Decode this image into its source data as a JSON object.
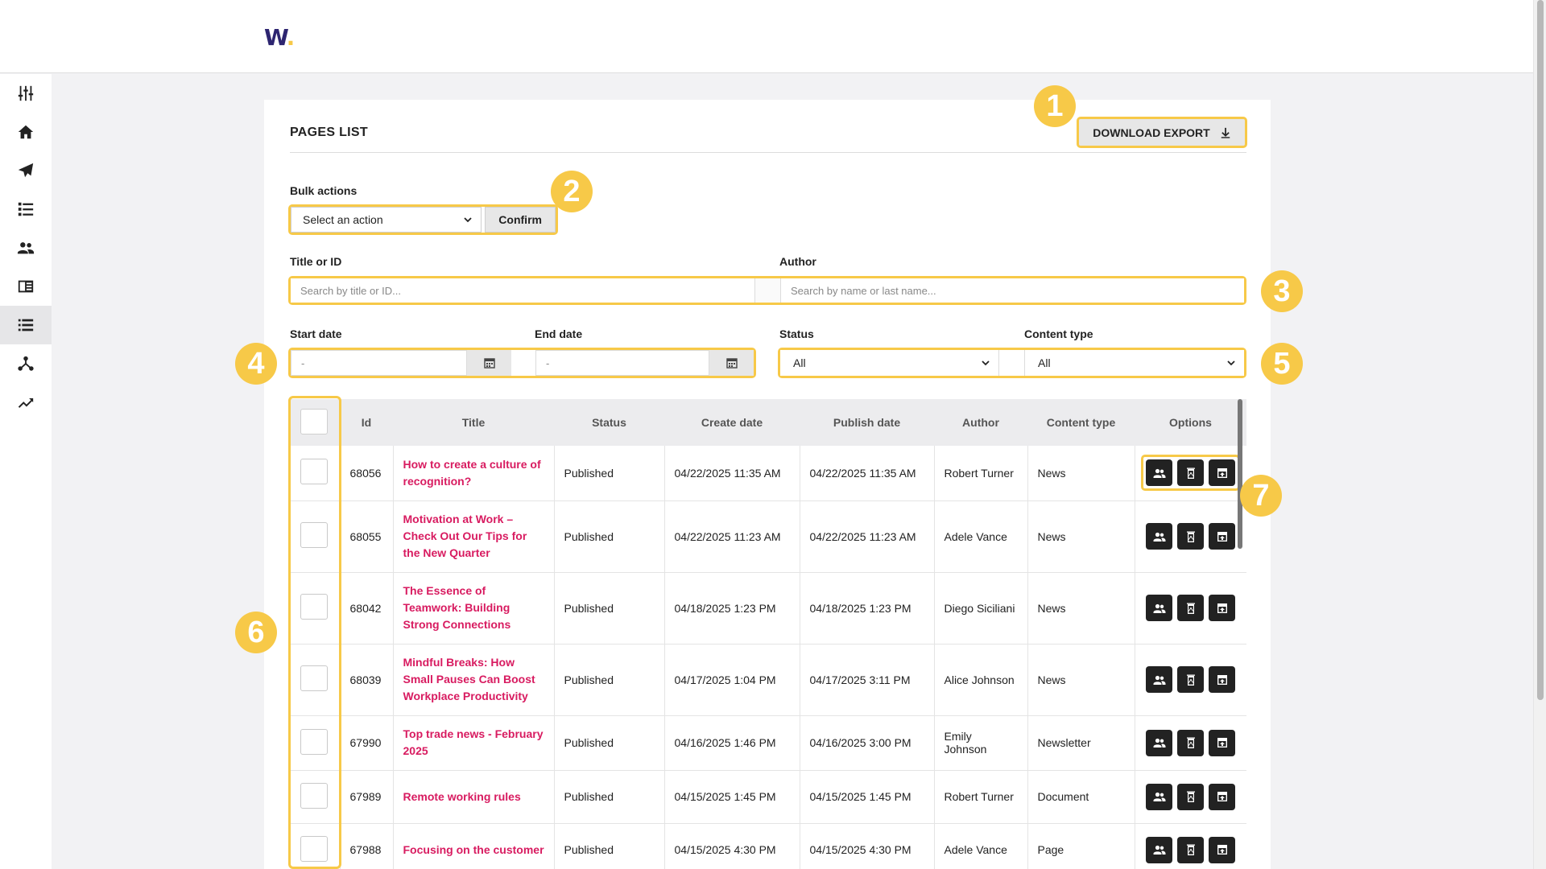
{
  "app": {
    "logo_text": "W",
    "logo_dot": "."
  },
  "colors": {
    "accent": "#f7c948",
    "title_link": "#d81b60",
    "brand": "#2d2570"
  },
  "sidebar": {
    "items": [
      {
        "icon": "sliders-icon"
      },
      {
        "icon": "home-icon"
      },
      {
        "icon": "paper-plane-icon"
      },
      {
        "icon": "list-icon"
      },
      {
        "icon": "users-icon"
      },
      {
        "icon": "newspaper-icon"
      },
      {
        "icon": "pages-icon",
        "active": true
      },
      {
        "icon": "network-icon"
      },
      {
        "icon": "trending-icon"
      }
    ]
  },
  "page": {
    "title": "PAGES LIST",
    "export_label": "DOWNLOAD EXPORT"
  },
  "bulk": {
    "label": "Bulk actions",
    "select_value": "Select an action",
    "confirm_label": "Confirm"
  },
  "search": {
    "title_label": "Title or ID",
    "title_placeholder": "Search by title or ID...",
    "author_label": "Author",
    "author_placeholder": "Search by name or last name..."
  },
  "dates": {
    "start_label": "Start date",
    "start_value": "-",
    "end_label": "End date",
    "end_value": "-"
  },
  "filters": {
    "status_label": "Status",
    "status_value": "All",
    "content_type_label": "Content type",
    "content_type_value": "All"
  },
  "markers": [
    "1",
    "2",
    "3",
    "4",
    "5",
    "6",
    "7"
  ],
  "table": {
    "headers": [
      "Id",
      "Title",
      "Status",
      "Create date",
      "Publish date",
      "Author",
      "Content type",
      "Options"
    ],
    "rows": [
      {
        "id": "68056",
        "title": "How to create a culture of recognition?",
        "status": "Published",
        "create": "04/22/2025 11:35 AM",
        "publish": "04/22/2025 11:35 AM",
        "author": "Robert Turner",
        "type": "News"
      },
      {
        "id": "68055",
        "title": "Motivation at Work – Check Out Our Tips for the New Quarter",
        "status": "Published",
        "create": "04/22/2025 11:23 AM",
        "publish": "04/22/2025 11:23 AM",
        "author": "Adele Vance",
        "type": "News"
      },
      {
        "id": "68042",
        "title": "The Essence of Teamwork: Building Strong Connections",
        "status": "Published",
        "create": "04/18/2025 1:23 PM",
        "publish": "04/18/2025 1:23 PM",
        "author": "Diego Siciliani",
        "type": "News"
      },
      {
        "id": "68039",
        "title": "Mindful Breaks: How Small Pauses Can Boost Workplace Productivity",
        "status": "Published",
        "create": "04/17/2025 1:04 PM",
        "publish": "04/17/2025 3:11 PM",
        "author": "Alice Johnson",
        "type": "News"
      },
      {
        "id": "67990",
        "title": "Top trade news - February 2025",
        "status": "Published",
        "create": "04/16/2025 1:46 PM",
        "publish": "04/16/2025 3:00 PM",
        "author": "Emily Johnson",
        "type": "Newsletter"
      },
      {
        "id": "67989",
        "title": "Remote working rules",
        "status": "Published",
        "create": "04/15/2025 1:45 PM",
        "publish": "04/15/2025 1:45 PM",
        "author": "Robert Turner",
        "type": "Document"
      },
      {
        "id": "67988",
        "title": "Focusing on the customer",
        "status": "Published",
        "create": "04/15/2025 4:30 PM",
        "publish": "04/15/2025 4:30 PM",
        "author": "Adele Vance",
        "type": "Page"
      }
    ]
  }
}
